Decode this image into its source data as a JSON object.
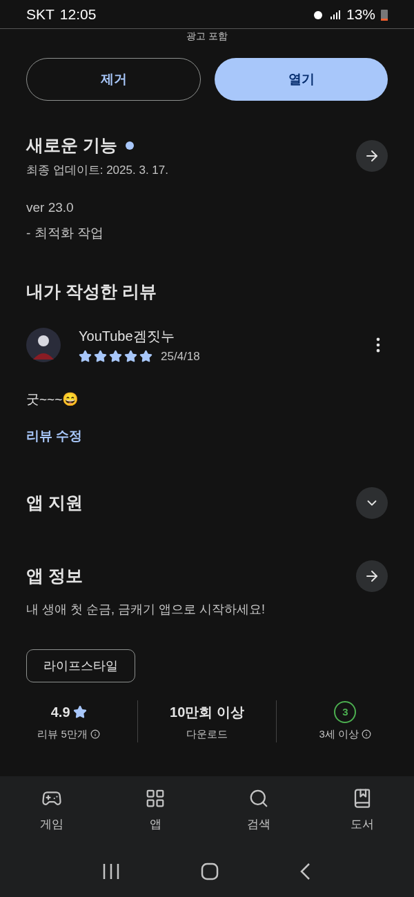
{
  "status_bar": {
    "carrier": "SKT",
    "time": "12:05",
    "battery": "13%"
  },
  "ad_note": "광고 포함",
  "buttons": [
    {
      "label": "제거",
      "kind": "outline"
    },
    {
      "label": "열기",
      "kind": "filled"
    }
  ],
  "whats_new": {
    "title": "새로운 기능",
    "new": true,
    "updated": "최종 업데이트: 2025. 3. 17.",
    "notes": [
      "ver 23.0",
      "- 최적화 작업"
    ]
  },
  "my_review": {
    "title": "내가 작성한 리뷰",
    "author": "YouTube겜짓누",
    "stars": 5,
    "date": "25/4/18",
    "text": "굿~~~😄",
    "edit_link": "리뷰 수정"
  },
  "app_support": {
    "title": "앱 지원",
    "expanded": false
  },
  "app_info": {
    "title": "앱 정보",
    "description": "내 생애 첫 순금, 금캐기 앱으로 시작하세요!",
    "tag": "라이프스타일"
  },
  "stats": [
    {
      "kind": "rating",
      "value": "4.9",
      "label": "리뷰 5만개"
    },
    {
      "kind": "text",
      "value": "10만회 이상",
      "label": "다운로드"
    },
    {
      "kind": "age",
      "value": "3",
      "label": "3세 이상"
    }
  ],
  "bottom_nav": [
    {
      "kind": "games",
      "label": "게임",
      "selected": false
    },
    {
      "kind": "apps",
      "label": "앱",
      "selected": false
    },
    {
      "kind": "search",
      "label": "검색",
      "selected": false
    },
    {
      "kind": "books",
      "label": "도서",
      "selected": false
    }
  ]
}
